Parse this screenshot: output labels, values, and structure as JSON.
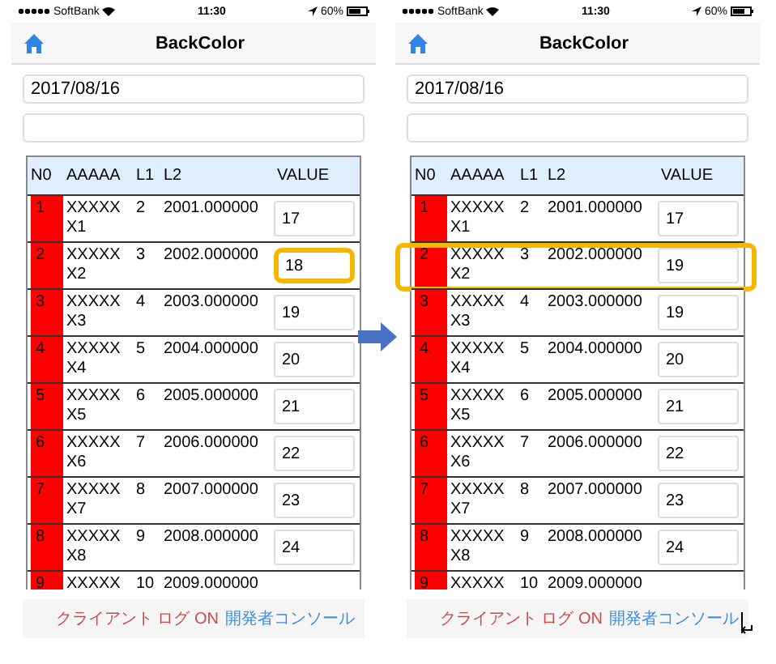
{
  "screens": [
    {
      "status_bar": {
        "carrier": "SoftBank",
        "time": "11:30",
        "battery": "60%"
      },
      "title": "BackColor",
      "date_field": {
        "value": "2017/08/16"
      },
      "columns": [
        "N0",
        "AAAAA",
        "L1",
        "L2",
        "VALUE"
      ],
      "rows": [
        {
          "no": "1",
          "a": "XXXXX X1",
          "l1": "2",
          "l2": "2001.000000",
          "value": "17",
          "value_highlighted": false,
          "row_highlighted": false
        },
        {
          "no": "2",
          "a": "XXXXX X2",
          "l1": "3",
          "l2": "2002.000000",
          "value": "18",
          "value_highlighted": true,
          "row_highlighted": false
        },
        {
          "no": "3",
          "a": "XXXXX X3",
          "l1": "4",
          "l2": "2003.000000",
          "value": "19",
          "value_highlighted": false,
          "row_highlighted": false
        },
        {
          "no": "4",
          "a": "XXXXX X4",
          "l1": "5",
          "l2": "2004.000000",
          "value": "20",
          "value_highlighted": false,
          "row_highlighted": false
        },
        {
          "no": "5",
          "a": "XXXXX X5",
          "l1": "6",
          "l2": "2005.000000",
          "value": "21",
          "value_highlighted": false,
          "row_highlighted": false
        },
        {
          "no": "6",
          "a": "XXXXX X6",
          "l1": "7",
          "l2": "2006.000000",
          "value": "22",
          "value_highlighted": false,
          "row_highlighted": false
        },
        {
          "no": "7",
          "a": "XXXXX X7",
          "l1": "8",
          "l2": "2007.000000",
          "value": "23",
          "value_highlighted": false,
          "row_highlighted": false
        },
        {
          "no": "8",
          "a": "XXXXX X8",
          "l1": "9",
          "l2": "2008.000000",
          "value": "24",
          "value_highlighted": false,
          "row_highlighted": false
        },
        {
          "no": "9",
          "a": "XXXXX",
          "l1": "10",
          "l2": "2009.000000"
        }
      ],
      "footer": {
        "log": "クライアント ログ ON",
        "console": "開発者コンソール"
      }
    },
    {
      "status_bar": {
        "carrier": "SoftBank",
        "time": "11:30",
        "battery": "60%"
      },
      "title": "BackColor",
      "date_field": {
        "value": "2017/08/16"
      },
      "columns": [
        "N0",
        "AAAAA",
        "L1",
        "L2",
        "VALUE"
      ],
      "rows": [
        {
          "no": "1",
          "a": "XXXXX X1",
          "l1": "2",
          "l2": "2001.000000",
          "value": "17",
          "value_highlighted": false,
          "row_highlighted": false
        },
        {
          "no": "2",
          "a": "XXXXX X2",
          "l1": "3",
          "l2": "2002.000000",
          "value": "19",
          "value_highlighted": false,
          "row_highlighted": true
        },
        {
          "no": "3",
          "a": "XXXXX X3",
          "l1": "4",
          "l2": "2003.000000",
          "value": "19",
          "value_highlighted": false,
          "row_highlighted": false
        },
        {
          "no": "4",
          "a": "XXXXX X4",
          "l1": "5",
          "l2": "2004.000000",
          "value": "20",
          "value_highlighted": false,
          "row_highlighted": false
        },
        {
          "no": "5",
          "a": "XXXXX X5",
          "l1": "6",
          "l2": "2005.000000",
          "value": "21",
          "value_highlighted": false,
          "row_highlighted": false
        },
        {
          "no": "6",
          "a": "XXXXX X6",
          "l1": "7",
          "l2": "2006.000000",
          "value": "22",
          "value_highlighted": false,
          "row_highlighted": false
        },
        {
          "no": "7",
          "a": "XXXXX X7",
          "l1": "8",
          "l2": "2007.000000",
          "value": "23",
          "value_highlighted": false,
          "row_highlighted": false
        },
        {
          "no": "8",
          "a": "XXXXX X8",
          "l1": "9",
          "l2": "2008.000000",
          "value": "24",
          "value_highlighted": false,
          "row_highlighted": false
        },
        {
          "no": "9",
          "a": "XXXXX",
          "l1": "10",
          "l2": "2009.000000"
        }
      ],
      "footer": {
        "log": "クライアント ログ ON",
        "console": "開発者コンソール"
      }
    }
  ]
}
